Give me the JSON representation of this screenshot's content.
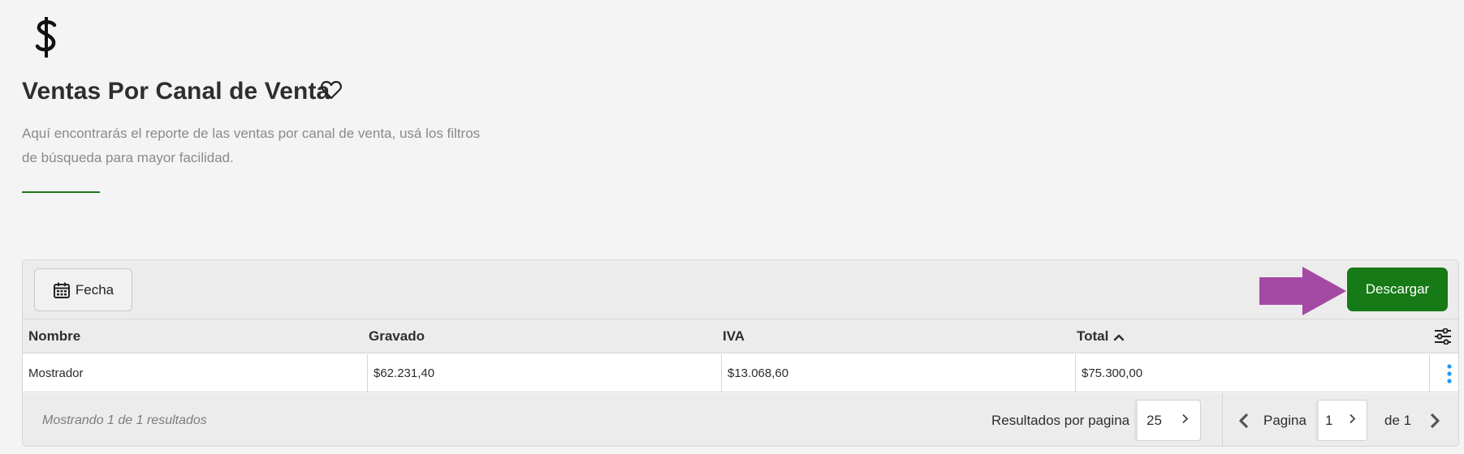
{
  "header": {
    "icon": "dollar-icon",
    "title": "Ventas Por Canal de Venta",
    "favorite_icon": "heart-icon",
    "description_line1": "Aquí encontrarás el reporte de las ventas por canal de venta, usá los filtros",
    "description_line2": "de búsqueda para mayor facilidad.",
    "accent_color": "#1f7a1f"
  },
  "toolbar": {
    "fecha_label": "Fecha",
    "fecha_icon": "calendar-icon",
    "download_label": "Descargar",
    "download_color": "#167a16",
    "annotation_arrow_color": "#a349a4"
  },
  "table": {
    "columns": [
      "Nombre",
      "Gravado",
      "IVA",
      "Total"
    ],
    "sorted_column": "Total",
    "sort_direction": "ascending",
    "rows": [
      [
        "Mostrador",
        "$62.231,40",
        "$13.068,60",
        "$75.300,00"
      ]
    ]
  },
  "footer": {
    "showing_text": "Mostrando 1 de 1 resultados",
    "results_per_page_label": "Resultados por pagina",
    "results_per_page_value": "25",
    "page_label": "Pagina",
    "page_value": "1",
    "page_of_label": "de 1"
  }
}
